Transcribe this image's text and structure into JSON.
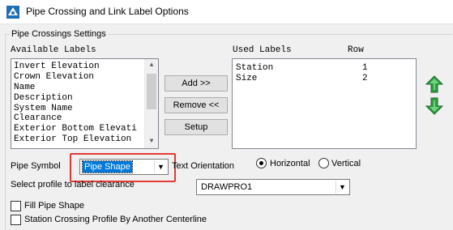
{
  "window": {
    "title": "Pipe Crossing and Link Label Options"
  },
  "group": {
    "legend": "Pipe Crossings Settings"
  },
  "available": {
    "header": "Available Labels",
    "items": [
      "Invert Elevation",
      "Crown Elevation",
      "Name",
      "Description",
      "System Name",
      "Clearance",
      "Exterior Bottom Elevati",
      "Exterior Top Elevation"
    ]
  },
  "used": {
    "header": "Used Labels",
    "row_header": "Row",
    "rows": [
      {
        "label": "Station",
        "row": "1"
      },
      {
        "label": "Size",
        "row": "2"
      }
    ]
  },
  "buttons": {
    "add": "Add >>",
    "remove": "Remove <<",
    "setup": "Setup"
  },
  "pipe_symbol": {
    "label": "Pipe Symbol",
    "value": "Pipe Shape"
  },
  "text_orientation": {
    "label": "Text Orientation",
    "horizontal": "Horizontal",
    "vertical": "Vertical",
    "selected": "Horizontal"
  },
  "profile": {
    "label": "Select profile to label clearance",
    "value": "DRAWPRO1"
  },
  "options": {
    "fill_pipe_shape": "Fill Pipe Shape",
    "station_crossing": "Station Crossing Profile By Another Centerline"
  },
  "colors": {
    "highlight": "#e53935",
    "selection": "#0078d7",
    "arrow_green": "#2e9e3f",
    "title_icon": "#1f6fb5"
  },
  "icons": {
    "app": "pipe-crossing-app-icon",
    "move_up": "green-up-arrow-icon",
    "move_down": "green-down-arrow-icon"
  }
}
